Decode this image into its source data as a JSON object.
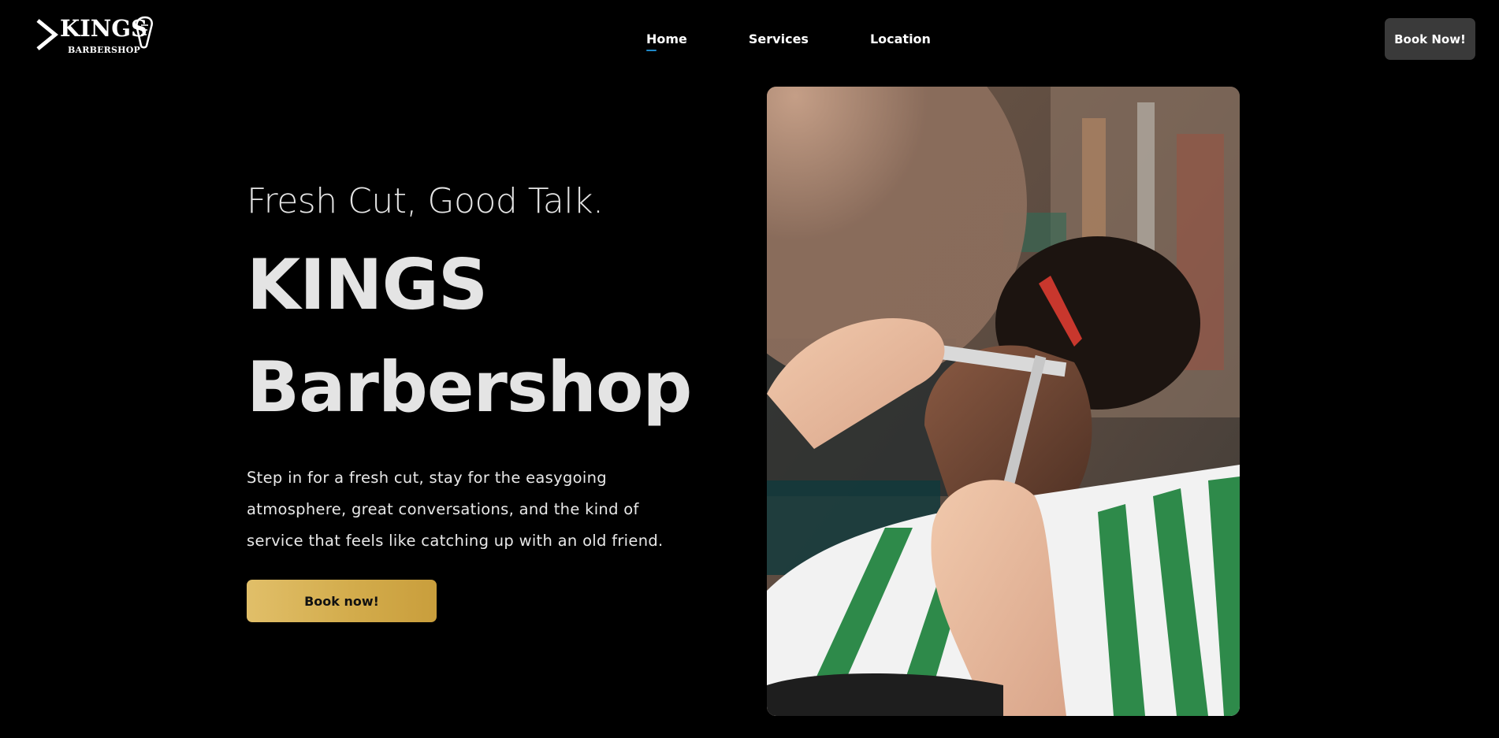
{
  "brand": {
    "name": "KINGS",
    "sub": "BARBERSHOP"
  },
  "nav": {
    "items": [
      {
        "label": "Home",
        "active": true
      },
      {
        "label": "Services",
        "active": false
      },
      {
        "label": "Location",
        "active": false
      }
    ],
    "active_indicator_color": "#1e88c8"
  },
  "header_cta": {
    "label": "Book Now!",
    "background": "#3a3a3a"
  },
  "hero": {
    "tagline": "Fresh Cut, Good Talk.",
    "title_line1": "KINGS",
    "title_line2": "Barbershop",
    "description": "Step in for a fresh cut, stay for the easygoing atmosphere, great conversations, and the kind of service that feels like catching up with an old friend.",
    "cta_label": "Book now!",
    "cta_color": "#d4ad4f",
    "image_icon": "barber-cutting-hair-photo"
  },
  "colors": {
    "background": "#000000",
    "text": "#e4e4e4"
  }
}
